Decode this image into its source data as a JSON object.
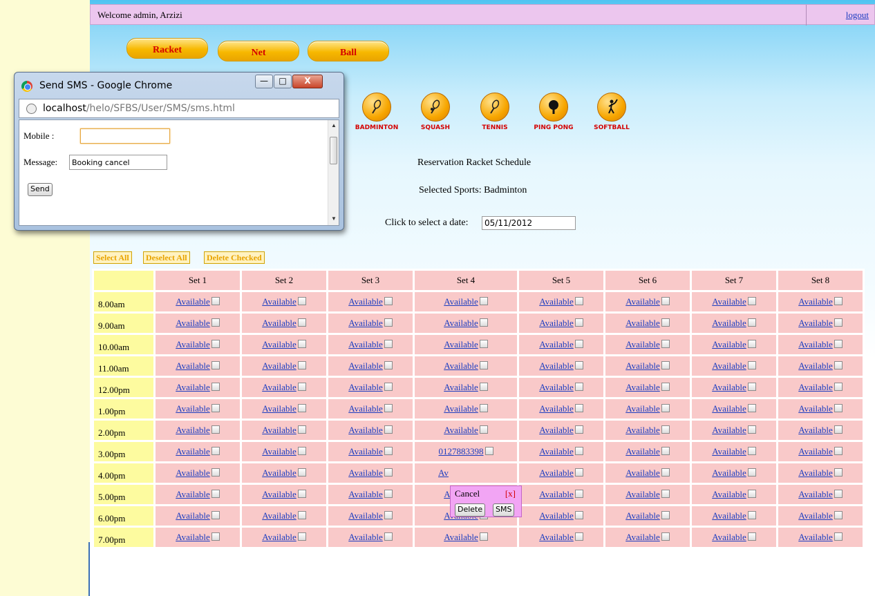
{
  "header": {
    "welcome": "Welcome admin, Arzizi",
    "logout": "logout"
  },
  "categories": [
    {
      "label": "Racket"
    },
    {
      "label": "Net"
    },
    {
      "label": "Ball"
    }
  ],
  "sports": [
    {
      "label": "BADMINTON",
      "icon": "badminton-racket-icon"
    },
    {
      "label": "SQUASH",
      "icon": "squash-racket-icon"
    },
    {
      "label": "TENNIS",
      "icon": "tennis-racket-icon"
    },
    {
      "label": "PING PONG",
      "icon": "ping-pong-paddle-icon"
    },
    {
      "label": "SOFTBALL",
      "icon": "softball-batter-icon"
    }
  ],
  "schedule": {
    "title": "Reservation Racket Schedule",
    "selected": "Selected Sports:  Badminton",
    "date_label": "Click to select a date:",
    "date_value": "05/11/2012",
    "actions": {
      "select_all": "Select All",
      "deselect_all": "Deselect All",
      "delete_checked": "Delete Checked"
    },
    "sets": [
      "Set 1",
      "Set 2",
      "Set 3",
      "Set 4",
      "Set 5",
      "Set 6",
      "Set 7",
      "Set 8"
    ],
    "times": [
      "8.00am",
      "9.00am",
      "10.00am",
      "11.00am",
      "12.00pm",
      "1.00pm",
      "2.00pm",
      "3.00pm",
      "4.00pm",
      "5.00pm",
      "6.00pm",
      "7.00pm"
    ],
    "cell_label": "Available",
    "booked": {
      "time": "3.00pm",
      "set": "Set 4",
      "label": "0127883398"
    },
    "partial_label": "Av"
  },
  "cancel_popup": {
    "title": "Cancel",
    "close": "[x]",
    "delete": "Delete",
    "sms": "SMS"
  },
  "sms_window": {
    "title": "Send SMS - Google Chrome",
    "url_host": "localhost",
    "url_path": "/helo/SFBS/User/SMS/sms.html",
    "mobile_label": "Mobile  :",
    "mobile_value": "",
    "message_label": "Message:",
    "message_value": "Booking cancel",
    "send": "Send",
    "minimize": "—",
    "maximize": "□",
    "close": "X"
  },
  "colors": {
    "accent_pill": "#f7b800",
    "cell_bg": "#f9c9c9",
    "time_bg": "#fdfb9f",
    "header_bg": "#ecc6ee",
    "popup_bg": "#f2a5f4",
    "link": "#1a3cc0"
  }
}
